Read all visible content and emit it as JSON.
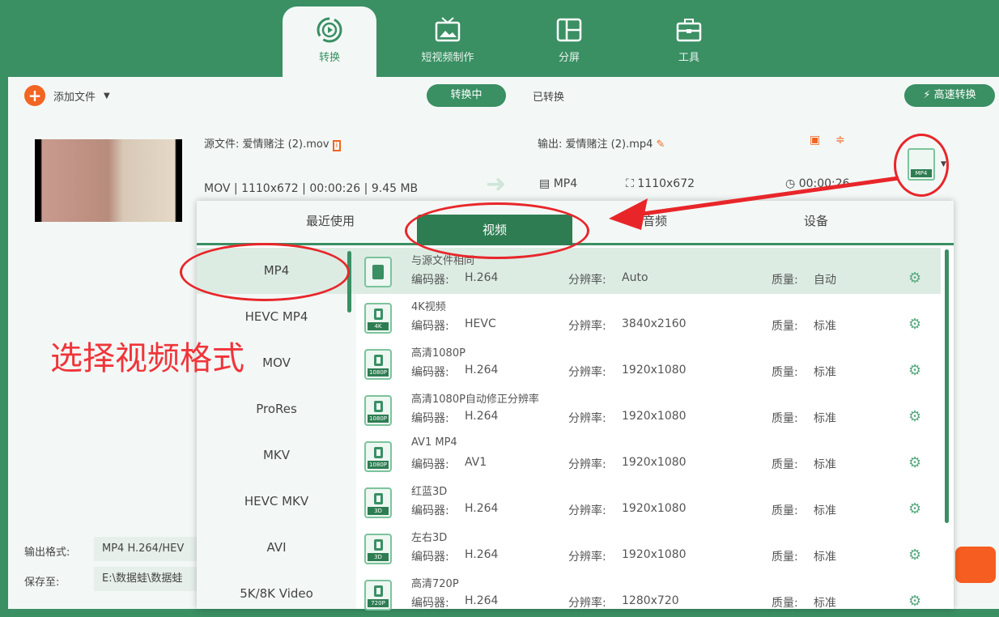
{
  "nav": {
    "tabs": [
      {
        "label": "转换",
        "active": true
      },
      {
        "label": "短视频制作"
      },
      {
        "label": "分屏"
      },
      {
        "label": "工具"
      }
    ]
  },
  "toolbar": {
    "add_file": "添加文件",
    "converting": "转换中",
    "converted": "已转换",
    "fast_convert": "高速转换"
  },
  "file": {
    "source_label": "源文件:",
    "source_name": "爱情赌注 (2).mov",
    "src_format": "MOV",
    "src_res": "1110x672",
    "src_dur": "00:00:26",
    "src_size": "9.45 MB",
    "output_label": "输出:",
    "output_name": "爱情赌注 (2).mp4",
    "out_format": "MP4",
    "out_res": "1110x672",
    "out_dur": "00:00:26",
    "format_badge": "MP4"
  },
  "popup": {
    "tabs": [
      "最近使用",
      "视频",
      "音频",
      "设备"
    ],
    "active_tab": 1,
    "categories": [
      "MP4",
      "HEVC MP4",
      "MOV",
      "ProRes",
      "MKV",
      "HEVC MKV",
      "AVI",
      "5K/8K Video"
    ],
    "encoder_label": "编码器:",
    "res_label": "分辨率:",
    "quality_label": "质量:",
    "presets": [
      {
        "name": "与源文件相同",
        "badge": "",
        "encoder": "H.264",
        "res": "Auto",
        "quality": "自动"
      },
      {
        "name": "4K视频",
        "badge": "4K",
        "encoder": "HEVC",
        "res": "3840x2160",
        "quality": "标准"
      },
      {
        "name": "高清1080P",
        "badge": "1080P",
        "encoder": "H.264",
        "res": "1920x1080",
        "quality": "标准"
      },
      {
        "name": "高清1080P自动修正分辨率",
        "badge": "1080P",
        "encoder": "H.264",
        "res": "1920x1080",
        "quality": "标准"
      },
      {
        "name": "AV1 MP4",
        "badge": "1080P",
        "encoder": "AV1",
        "res": "1920x1080",
        "quality": "标准"
      },
      {
        "name": "红蓝3D",
        "badge": "3D",
        "encoder": "H.264",
        "res": "1920x1080",
        "quality": "标准"
      },
      {
        "name": "左右3D",
        "badge": "3D",
        "encoder": "H.264",
        "res": "1920x1080",
        "quality": "标准"
      },
      {
        "name": "高清720P",
        "badge": "720P",
        "encoder": "H.264",
        "res": "1280x720",
        "quality": "标准"
      }
    ]
  },
  "bottom": {
    "format_label": "输出格式:",
    "format_value": "MP4 H.264/HEV",
    "save_label": "保存至:",
    "save_value": "E:\\数据蛙\\数据蛙"
  },
  "annotation": {
    "text": "选择视频格式"
  }
}
